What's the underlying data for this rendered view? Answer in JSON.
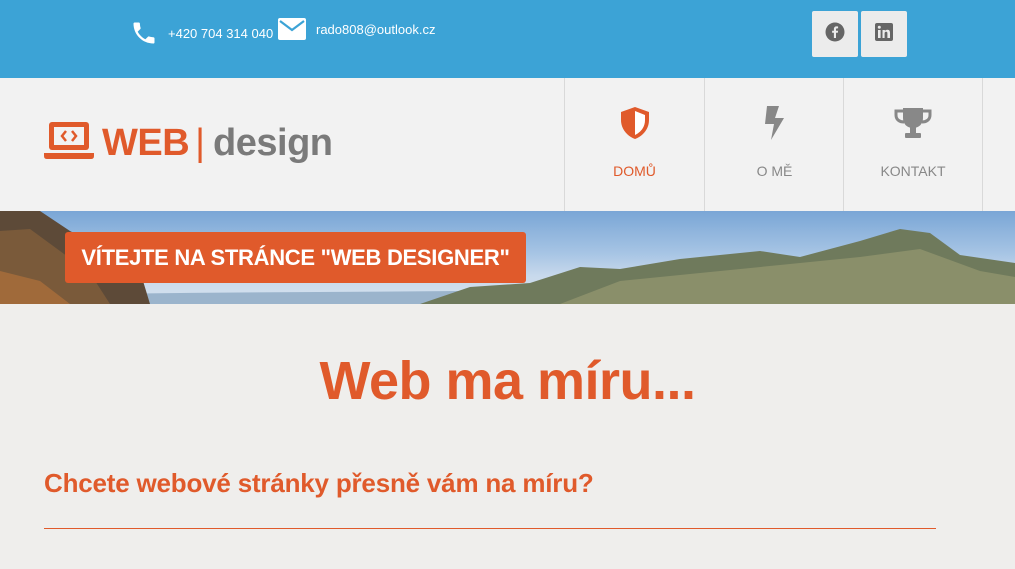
{
  "contact": {
    "phone": "+420 704 314 040",
    "email": "rado808@outlook.cz"
  },
  "social": [
    {
      "icon": "facebook-icon"
    },
    {
      "icon": "linkedin-icon"
    }
  ],
  "logo": {
    "web": "WEB",
    "separator": "|",
    "design": "design"
  },
  "nav": [
    {
      "label": "DOMŮ",
      "icon": "shield-icon",
      "active": true
    },
    {
      "label": "O MĚ",
      "icon": "lightning-icon",
      "active": false
    },
    {
      "label": "KONTAKT",
      "icon": "trophy-icon",
      "active": false
    }
  ],
  "banner": {
    "button_label": "VÍTEJTE NA STRÁNCE \"WEB DESIGNER\""
  },
  "main": {
    "title": "Web ma míru...",
    "subtitle": "Chcete webové stránky přesně vám na míru?"
  },
  "colors": {
    "topbar": "#3ca3d6",
    "accent": "#e05a2b",
    "header_bg": "#f2f2f2",
    "body_bg": "#efeeec",
    "muted": "#888888"
  }
}
